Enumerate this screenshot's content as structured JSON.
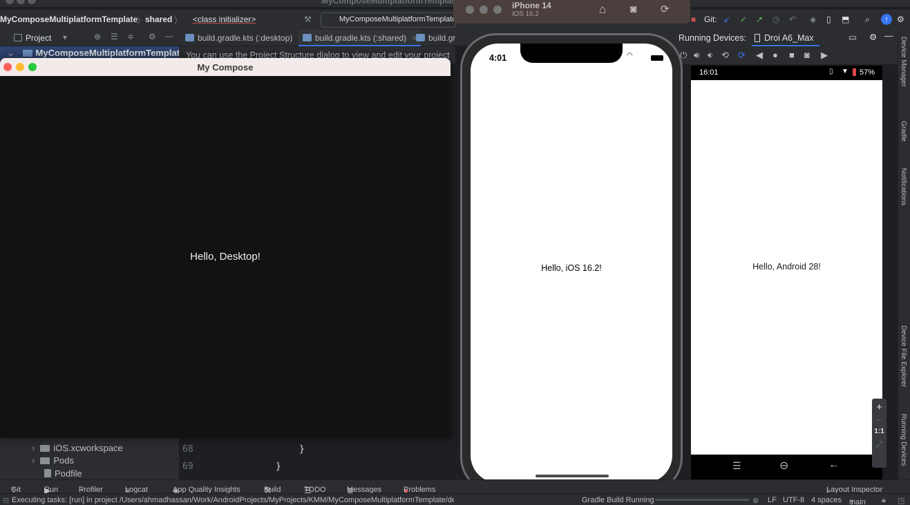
{
  "ide": {
    "window_title": "MyComposeMultiplatformTemplate",
    "breadcrumb": [
      "MyComposeMultiplatformTemplate",
      "shared",
      "<class initializer>"
    ],
    "run_config": "MyComposeMultiplatformTemplate:",
    "git_label": "Git:",
    "project_label": "Project",
    "root_label": "MyComposeMultiplatformTemplate",
    "project_hint": "You can use the Project Structure dialog to view and edit your project",
    "tabs": [
      {
        "label": "build.gradle.kts (:desktop)"
      },
      {
        "label": "build.gradle.kts (:shared)"
      },
      {
        "label": "build.gradle.kts"
      }
    ],
    "tree_items": [
      {
        "label": "iOS.xcworkspace"
      },
      {
        "label": "Pods"
      },
      {
        "label": "Podfile"
      }
    ],
    "code_lines": [
      {
        "number": "68",
        "text": "}"
      },
      {
        "number": "69",
        "text": "}"
      }
    ],
    "running_devices_label": "Running Devices:",
    "device_tab": "Droi A6_Max",
    "right_strip": [
      "Device Manager",
      "Gradle",
      "Notifications",
      "Device File Explorer",
      "Running Devices"
    ],
    "zoom": {
      "plus": "+",
      "minus": "−",
      "one_to_one": "1:1"
    },
    "bottom_tools": [
      "Git",
      "Run",
      "Profiler",
      "Logcat",
      "App Quality Insights",
      "Build",
      "TODO",
      "Messages",
      "Problems",
      "Layout Inspector"
    ],
    "status": {
      "task": "Executing tasks: [run] in project /Users/ahmadhassan/Work/AndroidProjects/MyProjects/KMM/MyComposeMultiplatformTemplate/desktop (a minute ago)",
      "gradle": "Gradle Build Running",
      "line_sep": "LF",
      "encoding": "UTF-8",
      "indent": "4 spaces",
      "branch": "main"
    },
    "accent_color": "#3574f0"
  },
  "desktop_window": {
    "title": "My Compose",
    "greeting": "Hello, Desktop!"
  },
  "ios_simulator": {
    "device_name": "iPhone 14",
    "os_version": "iOS 16.2",
    "time": "4:01",
    "greeting": "Hello, iOS 16.2!"
  },
  "android_emulator": {
    "time": "16:01",
    "battery": "57%",
    "greeting": "Hello, Android 28!"
  }
}
